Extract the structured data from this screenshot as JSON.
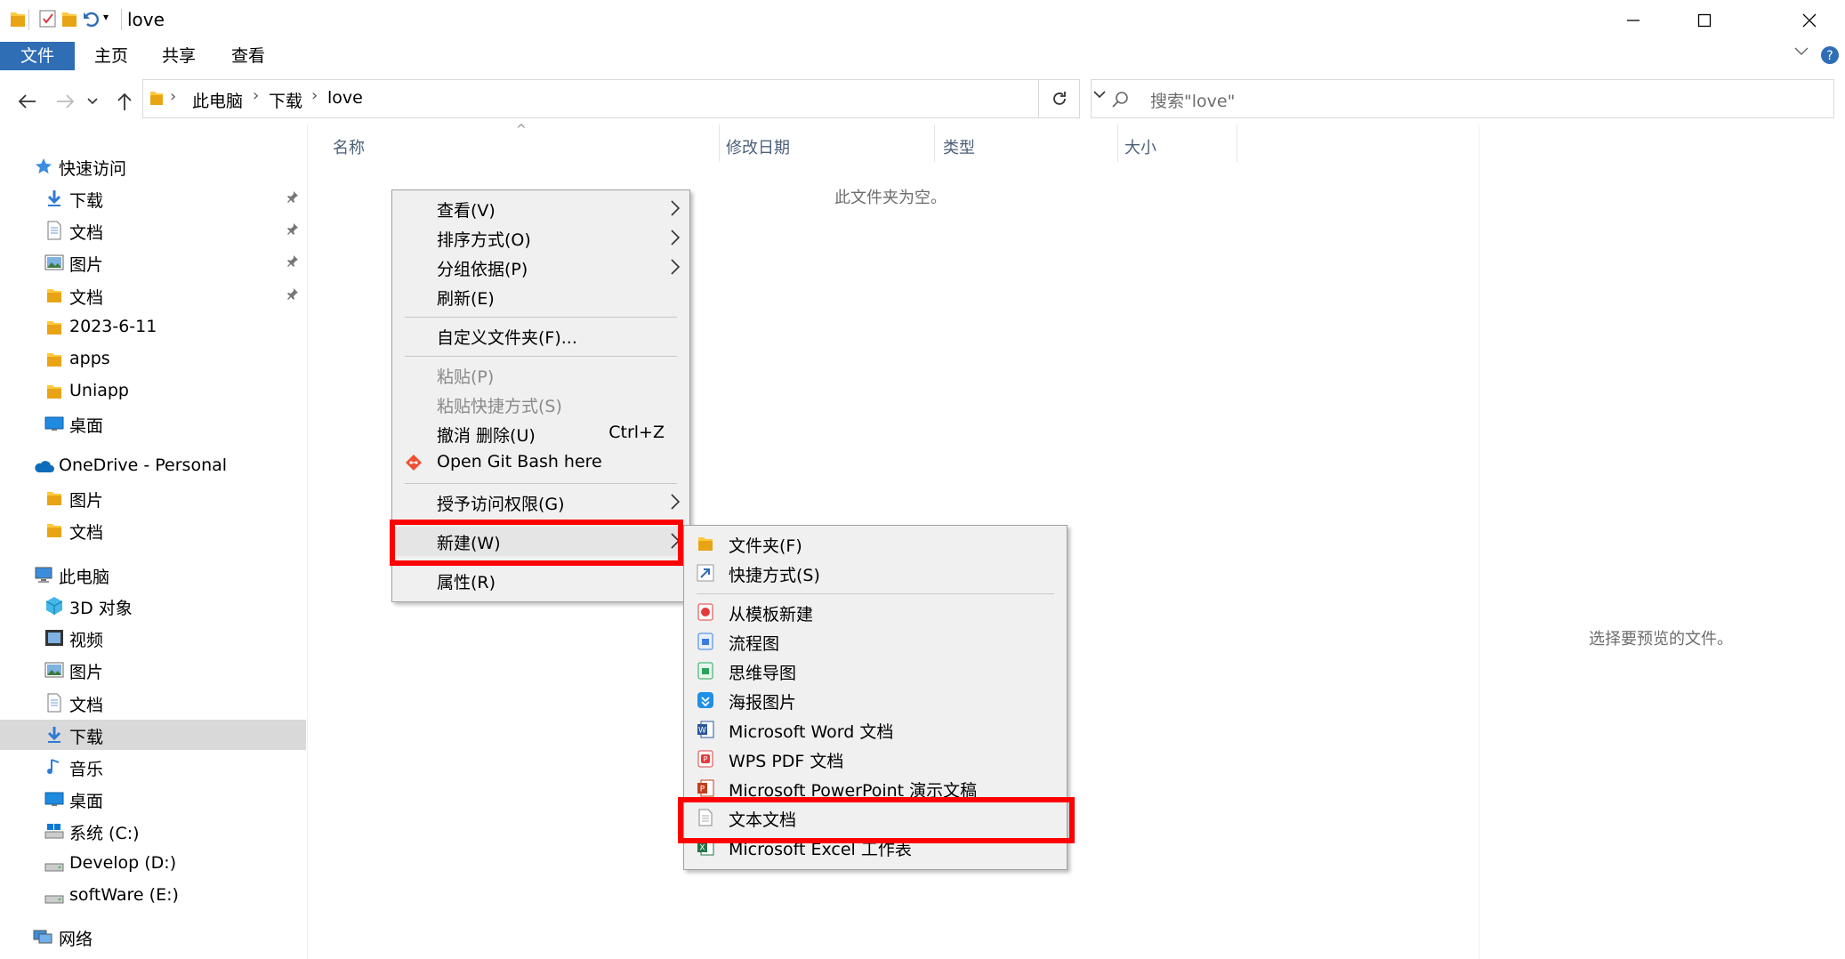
{
  "window": {
    "title": "love",
    "controls": [
      "minimize",
      "maximize",
      "close"
    ]
  },
  "ribbon": {
    "tabs": [
      "文件",
      "主页",
      "共享",
      "查看"
    ]
  },
  "address": {
    "crumbs": [
      "此电脑",
      "下载",
      "love"
    ],
    "search_placeholder": "搜索\"love\""
  },
  "sidebar": {
    "quick_access": {
      "label": "快速访问",
      "items": [
        {
          "label": "下载",
          "icon": "download-arrow-icon",
          "pinned": true
        },
        {
          "label": "文档",
          "icon": "document-icon",
          "pinned": true
        },
        {
          "label": "图片",
          "icon": "pictures-icon",
          "pinned": true
        },
        {
          "label": "文档",
          "icon": "folder-icon",
          "pinned": true
        },
        {
          "label": "2023-6-11",
          "icon": "folder-icon",
          "pinned": false
        },
        {
          "label": "apps",
          "icon": "folder-icon",
          "pinned": false
        },
        {
          "label": "Uniapp",
          "icon": "folder-icon",
          "pinned": false
        },
        {
          "label": "桌面",
          "icon": "desktop-icon",
          "pinned": false
        }
      ]
    },
    "onedrive": {
      "label": "OneDrive - Personal",
      "items": [
        {
          "label": "图片",
          "icon": "folder-icon"
        },
        {
          "label": "文档",
          "icon": "folder-icon"
        }
      ]
    },
    "this_pc": {
      "label": "此电脑",
      "items": [
        {
          "label": "3D 对象",
          "icon": "3d-objects-icon"
        },
        {
          "label": "视频",
          "icon": "video-icon"
        },
        {
          "label": "图片",
          "icon": "pictures-icon"
        },
        {
          "label": "文档",
          "icon": "document-icon"
        },
        {
          "label": "下载",
          "icon": "download-arrow-icon",
          "selected": true
        },
        {
          "label": "音乐",
          "icon": "music-icon"
        },
        {
          "label": "桌面",
          "icon": "desktop-icon"
        },
        {
          "label": "系统 (C:)",
          "icon": "drive-c-icon"
        },
        {
          "label": "Develop (D:)",
          "icon": "drive-icon"
        },
        {
          "label": "softWare (E:)",
          "icon": "drive-icon"
        }
      ]
    },
    "network": {
      "label": "网络"
    }
  },
  "columns": [
    "名称",
    "修改日期",
    "类型",
    "大小"
  ],
  "empty_message": "此文件夹为空。",
  "preview_message": "选择要预览的文件。",
  "context_menu": {
    "items": [
      {
        "label": "查看(V)",
        "submenu": true
      },
      {
        "label": "排序方式(O)",
        "submenu": true
      },
      {
        "label": "分组依据(P)",
        "submenu": true
      },
      {
        "label": "刷新(E)"
      },
      {
        "label": "自定义文件夹(F)..."
      },
      {
        "label": "粘贴(P)",
        "disabled": true
      },
      {
        "label": "粘贴快捷方式(S)",
        "disabled": true
      },
      {
        "label": "撤消 删除(U)",
        "shortcut": "Ctrl+Z"
      },
      {
        "label": "Open Git Bash here",
        "icon": "git-icon"
      },
      {
        "label": "授予访问权限(G)",
        "submenu": true
      },
      {
        "label": "新建(W)",
        "submenu": true,
        "highlighted": true
      },
      {
        "label": "属性(R)"
      }
    ]
  },
  "new_submenu": {
    "items": [
      {
        "label": "文件夹(F)",
        "icon": "folder-icon"
      },
      {
        "label": "快捷方式(S)",
        "icon": "shortcut-icon"
      },
      {
        "label": "从模板新建",
        "icon": "template-icon"
      },
      {
        "label": "流程图",
        "icon": "flowchart-icon"
      },
      {
        "label": "思维导图",
        "icon": "mindmap-icon"
      },
      {
        "label": "海报图片",
        "icon": "poster-icon"
      },
      {
        "label": "Microsoft Word 文档",
        "icon": "word-icon"
      },
      {
        "label": "WPS PDF 文档",
        "icon": "pdf-icon"
      },
      {
        "label": "Microsoft PowerPoint 演示文稿",
        "icon": "powerpoint-icon"
      },
      {
        "label": "文本文档",
        "icon": "text-document-icon",
        "highlighted": true
      },
      {
        "label": "Microsoft Excel 工作表",
        "icon": "excel-icon"
      }
    ]
  },
  "colors": {
    "accent": "#2f6db5",
    "highlight_box": "#ff0000",
    "folder": "#ffc83d",
    "selected_bg": "#d9d9d9"
  }
}
